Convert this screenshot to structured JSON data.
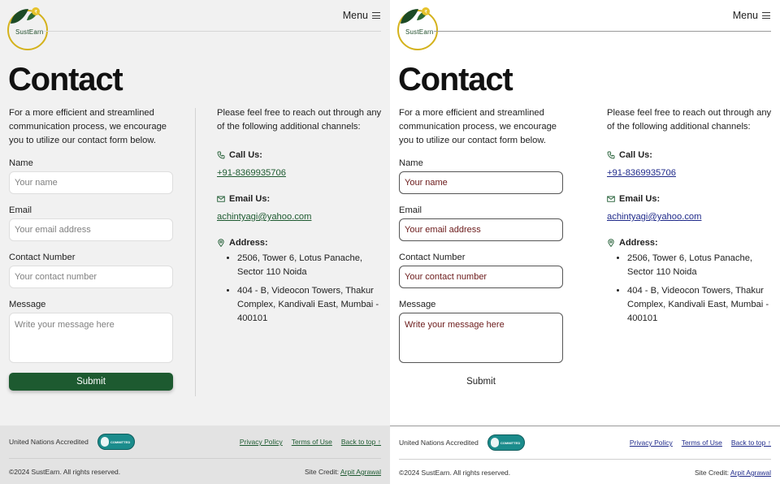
{
  "brand": {
    "name": "SustEarn"
  },
  "nav": {
    "menu_label": "Menu"
  },
  "page": {
    "title": "Contact",
    "intro": "For a more efficient and streamlined communication process, we encourage you to utilize our contact form below."
  },
  "form": {
    "name_label": "Name",
    "name_placeholder": "Your name",
    "email_label": "Email",
    "email_placeholder": "Your email address",
    "phone_label": "Contact Number",
    "phone_placeholder": "Your contact number",
    "message_label": "Message",
    "message_placeholder": "Write your message here",
    "submit_label": "Submit"
  },
  "channels": {
    "lead": "Please feel free to reach out through any of the following additional channels:",
    "call_heading": "Call Us:",
    "phone": "+91-8369935706",
    "email_heading": "Email Us:",
    "email": "achintyagi@yahoo.com",
    "address_heading": "Address:",
    "addresses": [
      "2506, Tower 6, Lotus Panache, Sector 110 Noida",
      "404 - B, Videocon Towers, Thakur Complex, Kandivali East, Mumbai - 400101"
    ]
  },
  "footer": {
    "accreditation": "United Nations Accredited",
    "badge_text": "COMMITTED",
    "privacy": "Privacy Policy",
    "terms": "Terms of Use",
    "back_to_top": "Back to top ↑",
    "copyright": "©2024 SustEarn. All rights reserved.",
    "credit_label": "Site Credit:",
    "credit_name": "Arpit Agrawal"
  },
  "colors": {
    "accent_green": "#1d5a30",
    "link_blue": "#1f2a8a",
    "logo_gold": "#d4b21c"
  },
  "icons": [
    "menu-icon",
    "phone-icon",
    "mail-icon",
    "location-pin-icon",
    "logo-leaf-icon"
  ]
}
